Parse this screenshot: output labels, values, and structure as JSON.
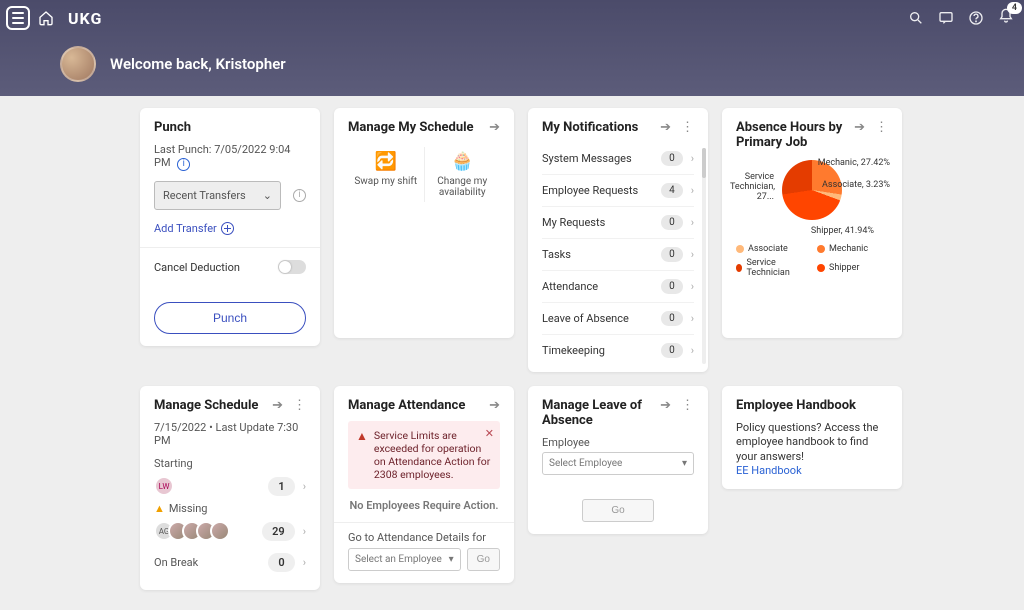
{
  "header": {
    "logo_text": "UKG",
    "notification_badge": "4",
    "welcome": "Welcome back, Kristopher"
  },
  "punch": {
    "title": "Punch",
    "last_label": "Last Punch: 7/05/2022 9:04 PM",
    "transfer_select": "Recent Transfers",
    "add_transfer": "Add Transfer",
    "cancel_deduction": "Cancel Deduction",
    "button": "Punch"
  },
  "manage_schedule": {
    "title": "Manage My Schedule",
    "swap": "Swap my shift",
    "change": "Change my availability"
  },
  "notifications": {
    "title": "My Notifications",
    "rows": [
      {
        "label": "System Messages",
        "count": "0"
      },
      {
        "label": "Employee Requests",
        "count": "4"
      },
      {
        "label": "My Requests",
        "count": "0"
      },
      {
        "label": "Tasks",
        "count": "0"
      },
      {
        "label": "Attendance",
        "count": "0"
      },
      {
        "label": "Leave of Absence",
        "count": "0"
      },
      {
        "label": "Timekeeping",
        "count": "0"
      }
    ]
  },
  "absence": {
    "title": "Absence Hours by Primary Job",
    "labels": {
      "mechanic": "Mechanic, 27.42%",
      "associate": "Associate, 3.23%",
      "shipper": "Shipper, 41.94%",
      "service_tech": "Service Technician, 27..."
    },
    "legend": [
      "Associate",
      "Mechanic",
      "Service Technician",
      "Shipper"
    ],
    "colors": {
      "Associate": "#ffb97a",
      "Mechanic": "#ff7a2e",
      "Service Technician": "#e43c00",
      "Shipper": "#ff4500"
    }
  },
  "manage_sched2": {
    "title": "Manage Schedule",
    "subtitle": "7/15/2022 • Last Update 7:30 PM",
    "starting": "Starting",
    "starting_count": "1",
    "missing": "Missing",
    "missing_count": "29",
    "onbreak": "On Break",
    "onbreak_count": "0"
  },
  "attendance": {
    "title": "Manage Attendance",
    "alert": "Service Limits are exceeded for operation on Attendance Action for 2308 employees.",
    "none": "No Employees Require Action.",
    "goto": "Go to Attendance Details for",
    "select_placeholder": "Select an Employee",
    "go": "Go"
  },
  "leave": {
    "title": "Manage Leave of Absence",
    "emp_label": "Employee",
    "select_placeholder": "Select Employee",
    "go": "Go"
  },
  "handbook": {
    "title": "Employee Handbook",
    "body": "Policy questions? Access the employee handbook to find your answers!",
    "link": "EE Handbook"
  },
  "chart_data": {
    "type": "pie",
    "title": "Absence Hours by Primary Job",
    "series": [
      {
        "name": "Mechanic",
        "value": 27.42
      },
      {
        "name": "Associate",
        "value": 3.23
      },
      {
        "name": "Shipper",
        "value": 41.94
      },
      {
        "name": "Service Technician",
        "value": 27.41
      }
    ]
  }
}
